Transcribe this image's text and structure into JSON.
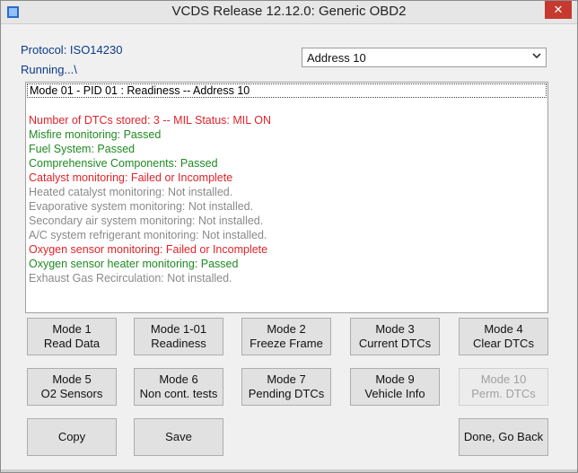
{
  "window": {
    "title": "VCDS Release 12.12.0:  Generic OBD2",
    "close_glyph": "✕"
  },
  "status": {
    "protocol": "Protocol: ISO14230",
    "running": "Running...\\"
  },
  "address_select": {
    "value": "Address 10"
  },
  "output": {
    "headline": "Mode 01 - PID 01 : Readiness  --  Address 10",
    "lines": [
      {
        "text": "Number of DTCs stored: 3  --  MIL Status: MIL ON",
        "color": "red"
      },
      {
        "text": "Misfire monitoring:  Passed",
        "color": "green"
      },
      {
        "text": "Fuel System:  Passed",
        "color": "green"
      },
      {
        "text": "Comprehensive Components:  Passed",
        "color": "green"
      },
      {
        "text": "Catalyst monitoring:  Failed or Incomplete",
        "color": "red"
      },
      {
        "text": "Heated catalyst monitoring: Not installed.",
        "color": "gray"
      },
      {
        "text": "Evaporative system monitoring: Not installed.",
        "color": "gray"
      },
      {
        "text": "Secondary air system monitoring: Not installed.",
        "color": "gray"
      },
      {
        "text": "A/C system refrigerant monitoring: Not installed.",
        "color": "gray"
      },
      {
        "text": "Oxygen sensor monitoring:  Failed or Incomplete",
        "color": "red"
      },
      {
        "text": "Oxygen sensor heater monitoring:  Passed",
        "color": "green"
      },
      {
        "text": "Exhaust Gas Recirculation: Not installed.",
        "color": "gray"
      }
    ]
  },
  "buttons": {
    "mode1": {
      "line1": "Mode 1",
      "line2": "Read Data"
    },
    "mode1_01": {
      "line1": "Mode 1-01",
      "line2": "Readiness"
    },
    "mode2": {
      "line1": "Mode 2",
      "line2": "Freeze Frame"
    },
    "mode3": {
      "line1": "Mode 3",
      "line2": "Current DTCs"
    },
    "mode4": {
      "line1": "Mode 4",
      "line2": "Clear DTCs"
    },
    "mode5": {
      "line1": "Mode 5",
      "line2": "O2 Sensors"
    },
    "mode6": {
      "line1": "Mode 6",
      "line2": "Non cont. tests"
    },
    "mode7": {
      "line1": "Mode 7",
      "line2": "Pending DTCs"
    },
    "mode9": {
      "line1": "Mode 9",
      "line2": "Vehicle Info"
    },
    "mode10": {
      "line1": "Mode 10",
      "line2": "Perm. DTCs"
    },
    "copy": "Copy",
    "save": "Save",
    "done": "Done, Go Back"
  },
  "colors": {
    "red": "#e0232a",
    "green": "#1f8a22",
    "gray": "#8a8a8a",
    "link_blue": "#0a3a8a",
    "close_red": "#c7392f"
  },
  "icons": {
    "app": "vcds-app-icon",
    "dropdown": "chevron-down-icon",
    "close": "close-icon"
  }
}
